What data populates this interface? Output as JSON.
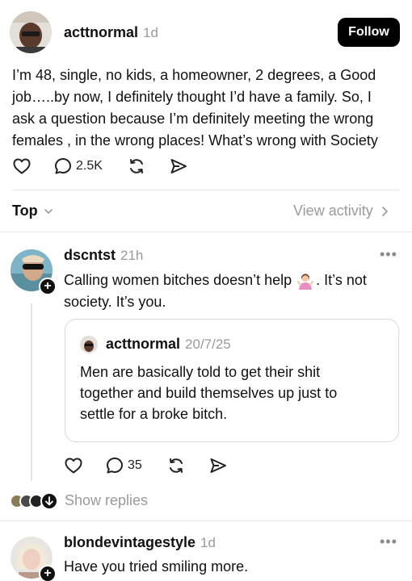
{
  "post": {
    "username": "acttnormal",
    "time": "1d",
    "follow_label": "Follow",
    "text_lines": [
      "I’m 48, single, no kids, a homeowner, 2 degrees, a Good",
      "job…..by now, I definitely thought I’d have a family.  So, I",
      "ask a question because I’m definitely meeting the wrong",
      "females , in the wrong places! What’s wrong with Society"
    ],
    "reply_count": "2.5K"
  },
  "sort_bar": {
    "sort_label": "Top",
    "view_activity_label": "View activity"
  },
  "reply1": {
    "username": "dscntst",
    "time": "21h",
    "text_line1_before_emoji": "Calling women bitches doesn’t help",
    "text_line1_after_emoji": ". It’s not",
    "text_line2": "society. It’s you.",
    "quote": {
      "username": "acttnormal",
      "time": "20/7/25",
      "text_lines": [
        "Men are basically  told  to get their  shit",
        "together and build themselves up just to",
        "settle for a broke bitch."
      ]
    },
    "reply_count": "35",
    "show_replies_label": "Show replies"
  },
  "reply2": {
    "username": "blondevintagestyle",
    "time": "1d",
    "text": "Have you tried smiling more."
  },
  "colors": {
    "text": "#111111",
    "muted": "#9a9a9a",
    "divider": "#e6e6e6",
    "follow_bg": "#000000"
  },
  "icons": [
    "heart-icon",
    "comment-icon",
    "repost-icon",
    "share-icon",
    "chevron-down-icon",
    "chevron-right-icon",
    "more-icon",
    "plus-icon"
  ]
}
